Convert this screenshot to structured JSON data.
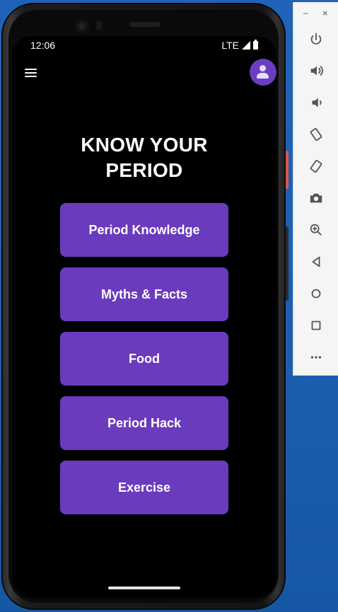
{
  "status_bar": {
    "time": "12:06",
    "network": "LTE"
  },
  "app": {
    "title": "KNOW YOUR\nPERIOD"
  },
  "menu": [
    {
      "label": "Period Knowledge"
    },
    {
      "label": "Myths & Facts"
    },
    {
      "label": "Food"
    },
    {
      "label": "Period Hack"
    },
    {
      "label": "Exercise"
    }
  ],
  "toolbar": {
    "minimize": "–",
    "close": "×",
    "items": [
      "power-icon",
      "volume-up-icon",
      "volume-down-icon",
      "rotate-left-icon",
      "rotate-right-icon",
      "camera-icon",
      "zoom-icon",
      "back-icon",
      "home-icon",
      "overview-icon",
      "more-icon"
    ]
  },
  "colors": {
    "accent": "#6a3bbd",
    "avatar": "#6a3fbf",
    "background": "#000000",
    "desktop": "#1c5fb2"
  }
}
